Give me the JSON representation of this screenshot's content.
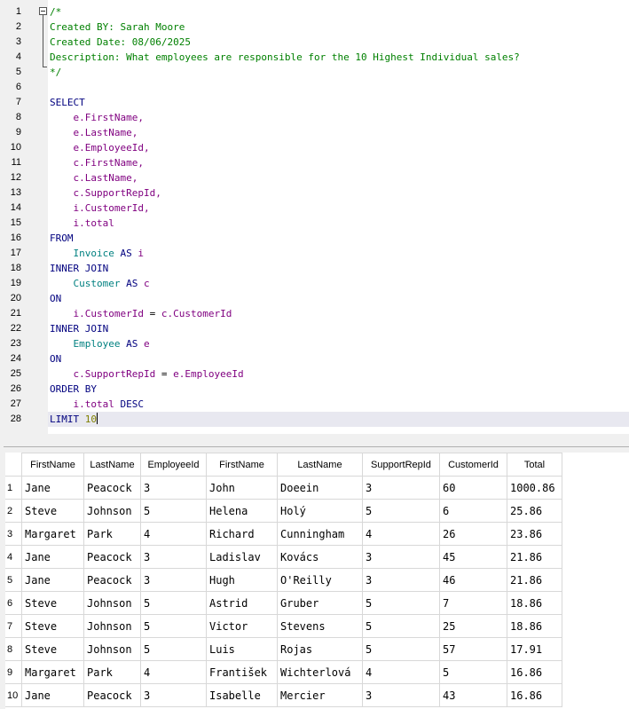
{
  "editor": {
    "line_numbers": [
      "1",
      "2",
      "3",
      "4",
      "5",
      "6",
      "7",
      "8",
      "9",
      "10",
      "11",
      "12",
      "13",
      "14",
      "15",
      "16",
      "17",
      "18",
      "19",
      "20",
      "21",
      "22",
      "23",
      "24",
      "25",
      "26",
      "27",
      "28"
    ],
    "comment_open": "/*",
    "comment_created_by": "Created BY: Sarah Moore",
    "comment_created_date": "Created Date: 08/06/2025",
    "comment_description": "Description: What employees are responsible for the 10 Highest Individual sales?",
    "comment_close": "*/",
    "kw_select": "SELECT",
    "select_fields": [
      "e.FirstName,",
      "e.LastName,",
      "e.EmployeeId,",
      "c.FirstName,",
      "c.LastName,",
      "c.SupportRepId,",
      "i.CustomerId,",
      "i.total"
    ],
    "kw_from": "FROM",
    "from_table": "Invoice",
    "kw_as": "AS",
    "from_alias": "i",
    "kw_inner_join": "INNER JOIN",
    "join1_table": "Customer",
    "join1_alias": "c",
    "kw_on": "ON",
    "join1_condition_left": "i.CustomerId",
    "op_eq": "=",
    "join1_condition_right": "c.CustomerId",
    "join2_table": "Employee",
    "join2_alias": "e",
    "join2_condition_left": "c.SupportRepId",
    "join2_condition_right": "e.EmployeeId",
    "kw_order_by": "ORDER BY",
    "order_field": "i.total",
    "kw_desc": "DESC",
    "kw_limit": "LIMIT",
    "limit_value": "10"
  },
  "results": {
    "columns": [
      "FirstName",
      "LastName",
      "EmployeeId",
      "FirstName",
      "LastName",
      "SupportRepId",
      "CustomerId",
      "Total"
    ],
    "rows": [
      [
        "1",
        "Jane",
        "Peacock",
        "3",
        "John",
        "Doeein",
        "3",
        "60",
        "1000.86"
      ],
      [
        "2",
        "Steve",
        "Johnson",
        "5",
        "Helena",
        "Holý",
        "5",
        "6",
        "25.86"
      ],
      [
        "3",
        "Margaret",
        "Park",
        "4",
        "Richard",
        "Cunningham",
        "4",
        "26",
        "23.86"
      ],
      [
        "4",
        "Jane",
        "Peacock",
        "3",
        "Ladislav",
        "Kovács",
        "3",
        "45",
        "21.86"
      ],
      [
        "5",
        "Jane",
        "Peacock",
        "3",
        "Hugh",
        "O'Reilly",
        "3",
        "46",
        "21.86"
      ],
      [
        "6",
        "Steve",
        "Johnson",
        "5",
        "Astrid",
        "Gruber",
        "5",
        "7",
        "18.86"
      ],
      [
        "7",
        "Steve",
        "Johnson",
        "5",
        "Victor",
        "Stevens",
        "5",
        "25",
        "18.86"
      ],
      [
        "8",
        "Steve",
        "Johnson",
        "5",
        "Luis",
        "Rojas",
        "5",
        "57",
        "17.91"
      ],
      [
        "9",
        "Margaret",
        "Park",
        "4",
        "František",
        "Wichterlová",
        "4",
        "5",
        "16.86"
      ],
      [
        "10",
        "Jane",
        "Peacock",
        "3",
        "Isabelle",
        "Mercier",
        "3",
        "43",
        "16.86"
      ]
    ]
  }
}
